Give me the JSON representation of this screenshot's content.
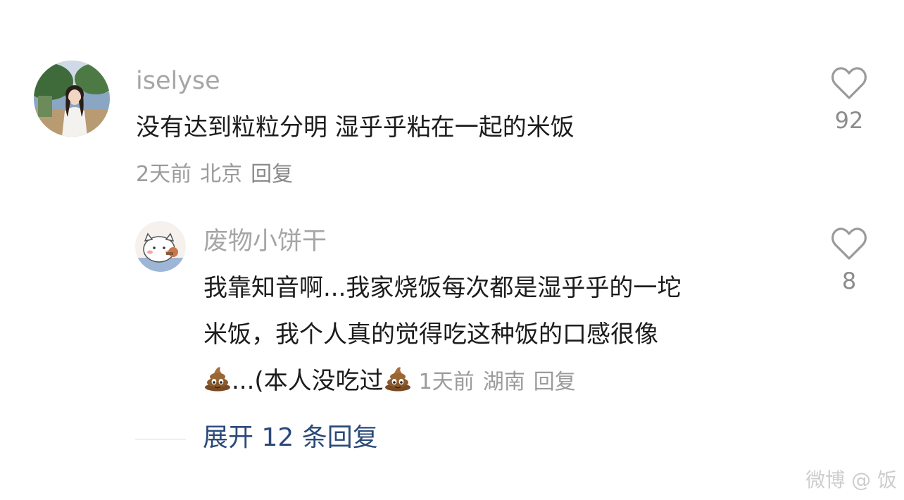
{
  "comments": [
    {
      "username": "iselyse",
      "content": "没有达到粒粒分明 湿乎乎粘在一起的米饭",
      "time": "2天前",
      "location": "北京",
      "reply_label": "回复",
      "likes": "92"
    },
    {
      "username": "废物小饼干",
      "line1": "我靠知音啊...我家烧饭每次都是湿乎乎的一坨",
      "line2": "米饭，我个人真的觉得吃这种饭的口感很像",
      "line3_part1": "...(本人没吃过",
      "time": "1天前",
      "location": "湖南",
      "reply_label": "回复",
      "likes": "8"
    }
  ],
  "expand_replies": "展开 12 条回复",
  "watermark": "微博 @ 饭"
}
